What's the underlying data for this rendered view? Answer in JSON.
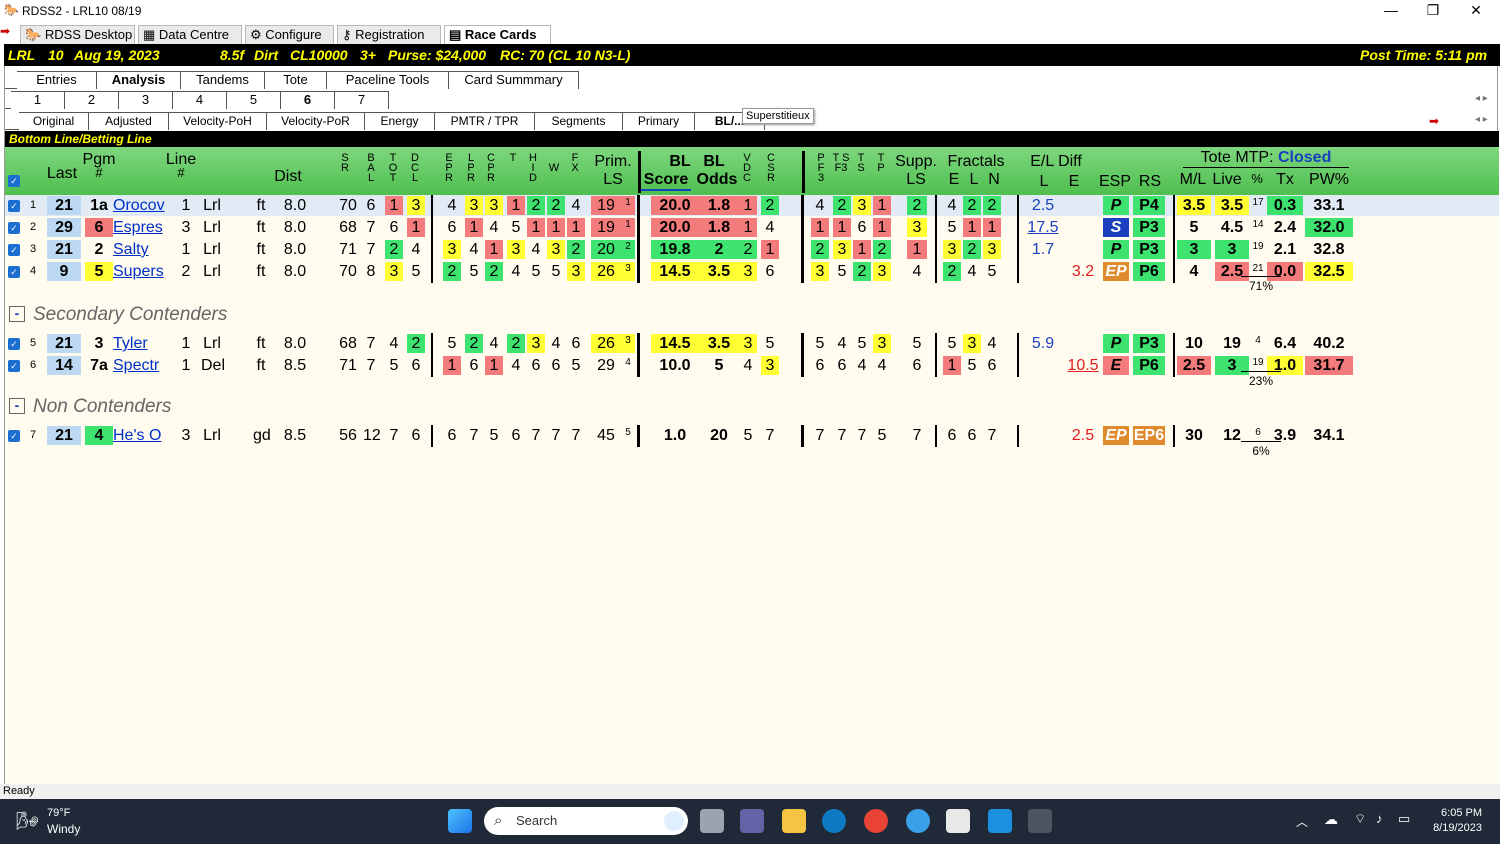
{
  "window": {
    "title": "RDSS2 - LRL10  08/19",
    "min": "—",
    "max": "❐",
    "close": "✕"
  },
  "app_tabs": [
    {
      "label": "RDSS Desktop",
      "icon": "horse-icon"
    },
    {
      "label": "Data Centre",
      "icon": "data-icon"
    },
    {
      "label": "Configure",
      "icon": "gear-icon"
    },
    {
      "label": "Registration",
      "icon": "key-icon"
    },
    {
      "label": "Race Cards",
      "icon": "card-icon",
      "active": true
    }
  ],
  "race": {
    "track": "LRL",
    "race_no": "10",
    "date": "Aug 19, 2023",
    "distance": "8.5f",
    "surface": "Dirt",
    "cond": "CL10000",
    "age": "3+",
    "purse": "Purse: $24,000",
    "rc": "RC: 70 (CL 10 N3-L)",
    "post_time": "Post Time: 5:11 pm"
  },
  "main_tabs": [
    "Entries",
    "Analysis",
    "Tandems",
    "Tote",
    "Paceline Tools",
    "Card Summmary"
  ],
  "main_tab_active": "Analysis",
  "race_tabs": [
    "1",
    "2",
    "3",
    "4",
    "5",
    "6",
    "7"
  ],
  "race_tab_active": "6",
  "sub_tabs": [
    "Original",
    "Adjusted",
    "Velocity-PoH",
    "Velocity-PoR",
    "Energy",
    "PMTR / TPR",
    "Segments",
    "Primary",
    "BL/..."
  ],
  "tooltip": "Superstitieux",
  "section_label": "Bottom Line/Betting Line",
  "headers": {
    "last": "Last",
    "pgm": "Pgm",
    "pgm_hash": "#",
    "line": "Line",
    "line_hash": "#",
    "dist": "Dist",
    "sr": "S R",
    "bal": "B A L",
    "tot": "T O T",
    "dcl": "D C L",
    "epr": "E P R",
    "lpr": "L P R",
    "cpr": "C P R",
    "t": "T",
    "hid": "H I D",
    "w": "W",
    "fx": "F X",
    "prim": "Prim.",
    "ls": "LS",
    "bl": "BL",
    "bl2": "BL",
    "score": "Score",
    "odds": "Odds",
    "vdc": "V D C",
    "csr": "C S R",
    "pf3": "P F 3",
    "tsf3": "T S F3",
    "ts": "T S",
    "tp": "T P",
    "supp": "Supp.",
    "supp_ls": "LS",
    "fractals": "Fractals",
    "fe": "E",
    "fl": "L",
    "fn": "N",
    "eldiff": "E/L Diff",
    "el_l": "L",
    "el_e": "E",
    "esp": "ESP",
    "rs": "RS",
    "tote_mtp": "Tote MTP:",
    "tote_status": "Closed",
    "ml": "M/L",
    "live": "Live",
    "pct": "%",
    "tx": "Tx",
    "pw": "PW%"
  },
  "rows_primary": [
    {
      "no": "1",
      "last": "21",
      "pgm": "1a",
      "name": "Orocov",
      "line": "1",
      "trk": "Lrl",
      "surf": "ft",
      "dist": "8.0",
      "sr": "70",
      "bal": "6",
      "tot": "1",
      "dcl": "3",
      "epr": "4",
      "lpr": "3",
      "cpr": "3",
      "t": "1",
      "hid": "2",
      "w": "2",
      "fx": "4",
      "prim": "19",
      "prim_r": "1",
      "score": "20.0",
      "odds": "1.8",
      "vdc": "1",
      "csr": "2",
      "pf3": "4",
      "tsf3": "2",
      "ts": "3",
      "tp": "1",
      "supp": "2",
      "fe": "4",
      "fl": "2",
      "fn": "2",
      "l": "2.5",
      "e": "",
      "esp": "P",
      "rs": "P4",
      "ml": "3.5",
      "live": "3.5",
      "pct": "17",
      "tx": "0.3",
      "pw": "33.1"
    },
    {
      "no": "2",
      "last": "29",
      "pgm": "6",
      "name": "Espres",
      "line": "3",
      "trk": "Lrl",
      "surf": "ft",
      "dist": "8.0",
      "sr": "68",
      "bal": "7",
      "tot": "6",
      "dcl": "1",
      "epr": "6",
      "lpr": "1",
      "cpr": "4",
      "t": "5",
      "hid": "1",
      "w": "1",
      "fx": "1",
      "prim": "19",
      "prim_r": "1",
      "score": "20.0",
      "odds": "1.8",
      "vdc": "1",
      "csr": "4",
      "pf3": "1",
      "tsf3": "1",
      "ts": "6",
      "tp": "1",
      "supp": "3",
      "fe": "5",
      "fl": "1",
      "fn": "1",
      "l": "17.5",
      "e": "",
      "esp": "S",
      "rs": "P3",
      "ml": "5",
      "live": "4.5",
      "pct": "14",
      "tx": "2.4",
      "pw": "32.0"
    },
    {
      "no": "3",
      "last": "21",
      "pgm": "2",
      "name": "Salty",
      "line": "1",
      "trk": "Lrl",
      "surf": "ft",
      "dist": "8.0",
      "sr": "71",
      "bal": "7",
      "tot": "2",
      "dcl": "4",
      "epr": "3",
      "lpr": "4",
      "cpr": "1",
      "t": "3",
      "hid": "4",
      "w": "3",
      "fx": "2",
      "prim": "20",
      "prim_r": "2",
      "score": "19.8",
      "odds": "2",
      "vdc": "2",
      "csr": "1",
      "pf3": "2",
      "tsf3": "3",
      "ts": "1",
      "tp": "2",
      "supp": "1",
      "fe": "3",
      "fl": "2",
      "fn": "3",
      "l": "1.7",
      "e": "",
      "esp": "P",
      "rs": "P3",
      "ml": "3",
      "live": "3",
      "pct": "19",
      "tx": "2.1",
      "pw": "32.8"
    },
    {
      "no": "4",
      "last": "9",
      "pgm": "5",
      "name": "Supers",
      "line": "2",
      "trk": "Lrl",
      "surf": "ft",
      "dist": "8.0",
      "sr": "70",
      "bal": "8",
      "tot": "3",
      "dcl": "5",
      "epr": "2",
      "lpr": "5",
      "cpr": "2",
      "t": "4",
      "hid": "5",
      "w": "5",
      "fx": "3",
      "prim": "26",
      "prim_r": "3",
      "score": "14.5",
      "odds": "3.5",
      "vdc": "3",
      "csr": "6",
      "pf3": "3",
      "tsf3": "5",
      "ts": "2",
      "tp": "3",
      "supp": "4",
      "fe": "2",
      "fl": "4",
      "fn": "5",
      "l": "",
      "e": "3.2",
      "esp": "EP",
      "rs": "P6",
      "ml": "4",
      "live": "2.5",
      "pct": "21",
      "tx": "0.0",
      "pw": "32.5"
    }
  ],
  "primary_total": "71%",
  "secondary_label": "Secondary Contenders",
  "rows_secondary": [
    {
      "no": "5",
      "last": "21",
      "pgm": "3",
      "name": "Tyler",
      "line": "1",
      "trk": "Lrl",
      "surf": "ft",
      "dist": "8.0",
      "sr": "68",
      "bal": "7",
      "tot": "4",
      "dcl": "2",
      "epr": "5",
      "lpr": "2",
      "cpr": "4",
      "t": "2",
      "hid": "3",
      "w": "4",
      "fx": "6",
      "prim": "26",
      "prim_r": "3",
      "score": "14.5",
      "odds": "3.5",
      "vdc": "3",
      "csr": "5",
      "pf3": "5",
      "tsf3": "4",
      "ts": "5",
      "tp": "3",
      "supp": "5",
      "fe": "5",
      "fl": "3",
      "fn": "4",
      "l": "5.9",
      "e": "",
      "esp": "P",
      "rs": "P3",
      "ml": "10",
      "live": "19",
      "pct": "4",
      "tx": "6.4",
      "pw": "40.2"
    },
    {
      "no": "6",
      "last": "14",
      "pgm": "7a",
      "name": "Spectr",
      "line": "1",
      "trk": "Del",
      "surf": "ft",
      "dist": "8.5",
      "sr": "71",
      "bal": "7",
      "tot": "5",
      "dcl": "6",
      "epr": "1",
      "lpr": "6",
      "cpr": "1",
      "t": "4",
      "hid": "6",
      "w": "6",
      "fx": "5",
      "prim": "29",
      "prim_r": "4",
      "score": "10.0",
      "odds": "5",
      "vdc": "4",
      "csr": "3",
      "pf3": "6",
      "tsf3": "6",
      "ts": "4",
      "tp": "4",
      "supp": "6",
      "fe": "1",
      "fl": "5",
      "fn": "6",
      "l": "",
      "e": "10.5",
      "esp": "E",
      "rs": "P6",
      "ml": "2.5",
      "live": "3",
      "pct": "19",
      "tx": "1.0",
      "pw": "31.7"
    }
  ],
  "secondary_total": "23%",
  "non_label": "Non Contenders",
  "rows_non": [
    {
      "no": "7",
      "last": "21",
      "pgm": "4",
      "name": "He's O",
      "line": "3",
      "trk": "Lrl",
      "surf": "gd",
      "dist": "8.5",
      "sr": "56",
      "bal": "12",
      "tot": "7",
      "dcl": "6",
      "epr": "6",
      "lpr": "7",
      "cpr": "5",
      "t": "6",
      "hid": "7",
      "w": "7",
      "fx": "7",
      "prim": "45",
      "prim_r": "5",
      "score": "1.0",
      "odds": "20",
      "vdc": "5",
      "csr": "7",
      "pf3": "7",
      "tsf3": "7",
      "ts": "7",
      "tp": "5",
      "supp": "7",
      "fe": "6",
      "fl": "6",
      "fn": "7",
      "l": "",
      "e": "2.5",
      "esp": "EP",
      "rs": "EP6",
      "ml": "30",
      "live": "12",
      "pct": "6",
      "tx": "3.9",
      "pw": "34.1"
    }
  ],
  "non_total": "6%",
  "status": "Ready",
  "taskbar": {
    "temp": "79°F",
    "weather": "Windy",
    "search": "Search",
    "time": "6:05 PM",
    "date": "8/19/2023"
  }
}
